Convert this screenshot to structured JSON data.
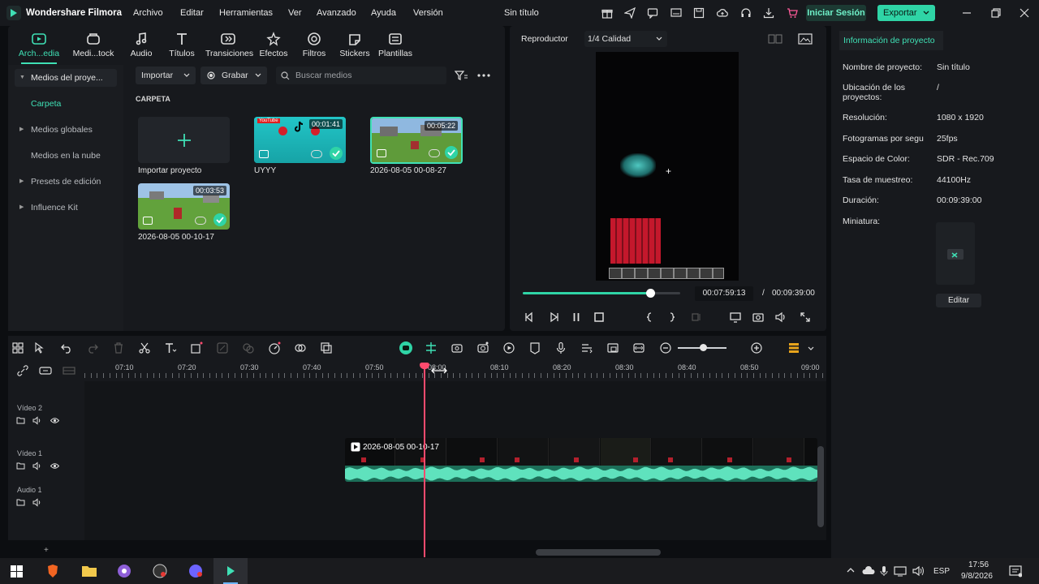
{
  "app": {
    "name": "Wondershare Filmora",
    "project_title": "Sin título"
  },
  "menu": [
    "Archivo",
    "Editar",
    "Herramientas",
    "Ver",
    "Avanzado",
    "Ayuda",
    "Versión"
  ],
  "titlebar": {
    "login_label": "Iniciar Sesión",
    "export_label": "Exportar"
  },
  "media_tabs": [
    {
      "label": "Arch...edia",
      "icon": "media-icon"
    },
    {
      "label": "Medi...tock",
      "icon": "stock-icon"
    },
    {
      "label": "Audio",
      "icon": "music-note-icon"
    },
    {
      "label": "Títulos",
      "icon": "text-icon"
    },
    {
      "label": "Transiciones",
      "icon": "transition-icon"
    },
    {
      "label": "Efectos",
      "icon": "effects-icon"
    },
    {
      "label": "Filtros",
      "icon": "filter-icon"
    },
    {
      "label": "Stickers",
      "icon": "sticker-icon"
    },
    {
      "label": "Plantillas",
      "icon": "template-icon"
    }
  ],
  "sidebar": {
    "items": [
      {
        "label": "Medios del proye...",
        "arrow": "▼"
      },
      {
        "label": "Carpeta",
        "arrow": ""
      },
      {
        "label": "Medios globales",
        "arrow": "▶"
      },
      {
        "label": "Medios en la nube",
        "arrow": ""
      },
      {
        "label": "Presets de edición",
        "arrow": "▶"
      },
      {
        "label": "Influence Kit",
        "arrow": "▶"
      }
    ]
  },
  "media_toolbar": {
    "import_label": "Importar",
    "record_label": "Grabar",
    "search_placeholder": "Buscar medios"
  },
  "folder_label": "CARPETA",
  "media_items": [
    {
      "caption": "Importar proyecto",
      "type": "import"
    },
    {
      "caption": "UYYY",
      "duration": "00:01:41"
    },
    {
      "caption": "2026-08-05 00-08-27",
      "duration": "00:05:22"
    },
    {
      "caption": "2026-08-05 00-10-17",
      "duration": "00:03:53"
    }
  ],
  "player": {
    "tab_label": "Reproductor",
    "quality": "1/4 Calidad",
    "current_time": "00:07:59:13",
    "separator": "/",
    "total_time": "00:09:39:00",
    "progress": 0.81
  },
  "project_info": {
    "tab_label": "Información de proyecto",
    "fields": [
      {
        "label": "Nombre de proyecto:",
        "value": "Sin título"
      },
      {
        "label": "Ubicación de los proyectos:",
        "value": "/"
      },
      {
        "label": "Resolución:",
        "value": "1080 x 1920"
      },
      {
        "label": "Fotogramas por segu",
        "value": "25fps"
      },
      {
        "label": "Espacio de Color:",
        "value": "SDR - Rec.709"
      },
      {
        "label": "Tasa de muestreo:",
        "value": "44100Hz"
      },
      {
        "label": "Duración:",
        "value": "00:09:39:00"
      },
      {
        "label": "Miniatura:",
        "value": ""
      }
    ],
    "edit_label": "Editar"
  },
  "ruler_ticks": [
    "07:10",
    "07:20",
    "07:30",
    "07:40",
    "07:50",
    "08:00",
    "08:10",
    "08:20",
    "08:30",
    "08:40",
    "08:50",
    "09:00"
  ],
  "tracks": [
    {
      "name": "Vídeo 2"
    },
    {
      "name": "Vídeo 1"
    },
    {
      "name": "Audio 1"
    }
  ],
  "clip": {
    "title": "2026-08-05 00-10-17"
  },
  "taskbar": {
    "lang": "ESP",
    "time": "17:56",
    "date": "9/8/2026"
  },
  "colors": {
    "accent": "#2fd4a6",
    "playhead": "#ff4b6e",
    "panel": "#17191d"
  }
}
